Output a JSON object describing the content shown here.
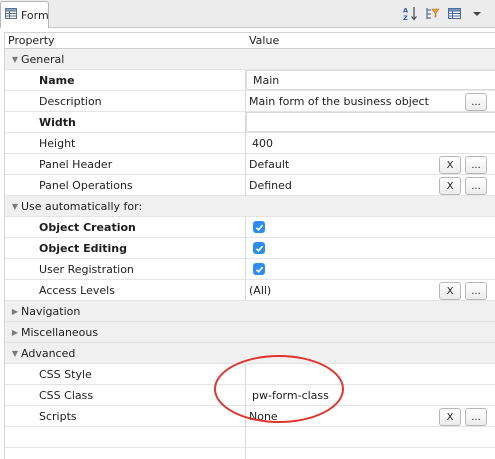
{
  "tab": {
    "label": "Form",
    "icon": "table-icon"
  },
  "toolbar": {
    "icons": [
      "sort-az-icon",
      "filter-icon",
      "table-view-icon",
      "view-menu-icon"
    ]
  },
  "columns": {
    "property": "Property",
    "value": "Value"
  },
  "categories": {
    "general": "General",
    "use_automatically": "Use automatically for:",
    "navigation": "Navigation",
    "miscellaneous": "Miscellaneous",
    "advanced": "Advanced"
  },
  "rows": {
    "name": {
      "label": "Name",
      "value": "Main"
    },
    "description": {
      "label": "Description",
      "value": "Main form of the business object",
      "button": "..."
    },
    "width": {
      "label": "Width",
      "value": ""
    },
    "height": {
      "label": "Height",
      "value": "400"
    },
    "panel_header": {
      "label": "Panel Header",
      "value": "Default",
      "clear": "X",
      "button": "..."
    },
    "panel_operations": {
      "label": "Panel Operations",
      "value": "Defined",
      "clear": "X",
      "button": "..."
    },
    "object_creation": {
      "label": "Object Creation",
      "checked": true
    },
    "object_editing": {
      "label": "Object Editing",
      "checked": true
    },
    "user_registration": {
      "label": "User Registration",
      "checked": true
    },
    "access_levels": {
      "label": "Access Levels",
      "value": "(All)",
      "clear": "X",
      "button": "..."
    },
    "css_style": {
      "label": "CSS Style",
      "value": ""
    },
    "css_class": {
      "label": "CSS Class",
      "value": "pw-form-class"
    },
    "scripts": {
      "label": "Scripts",
      "value": "None",
      "clear": "X",
      "button": "..."
    }
  },
  "colors": {
    "highlight": "#e0342c",
    "checkbox": "#2d8cf0",
    "category_bg": "#f0f0f0"
  }
}
